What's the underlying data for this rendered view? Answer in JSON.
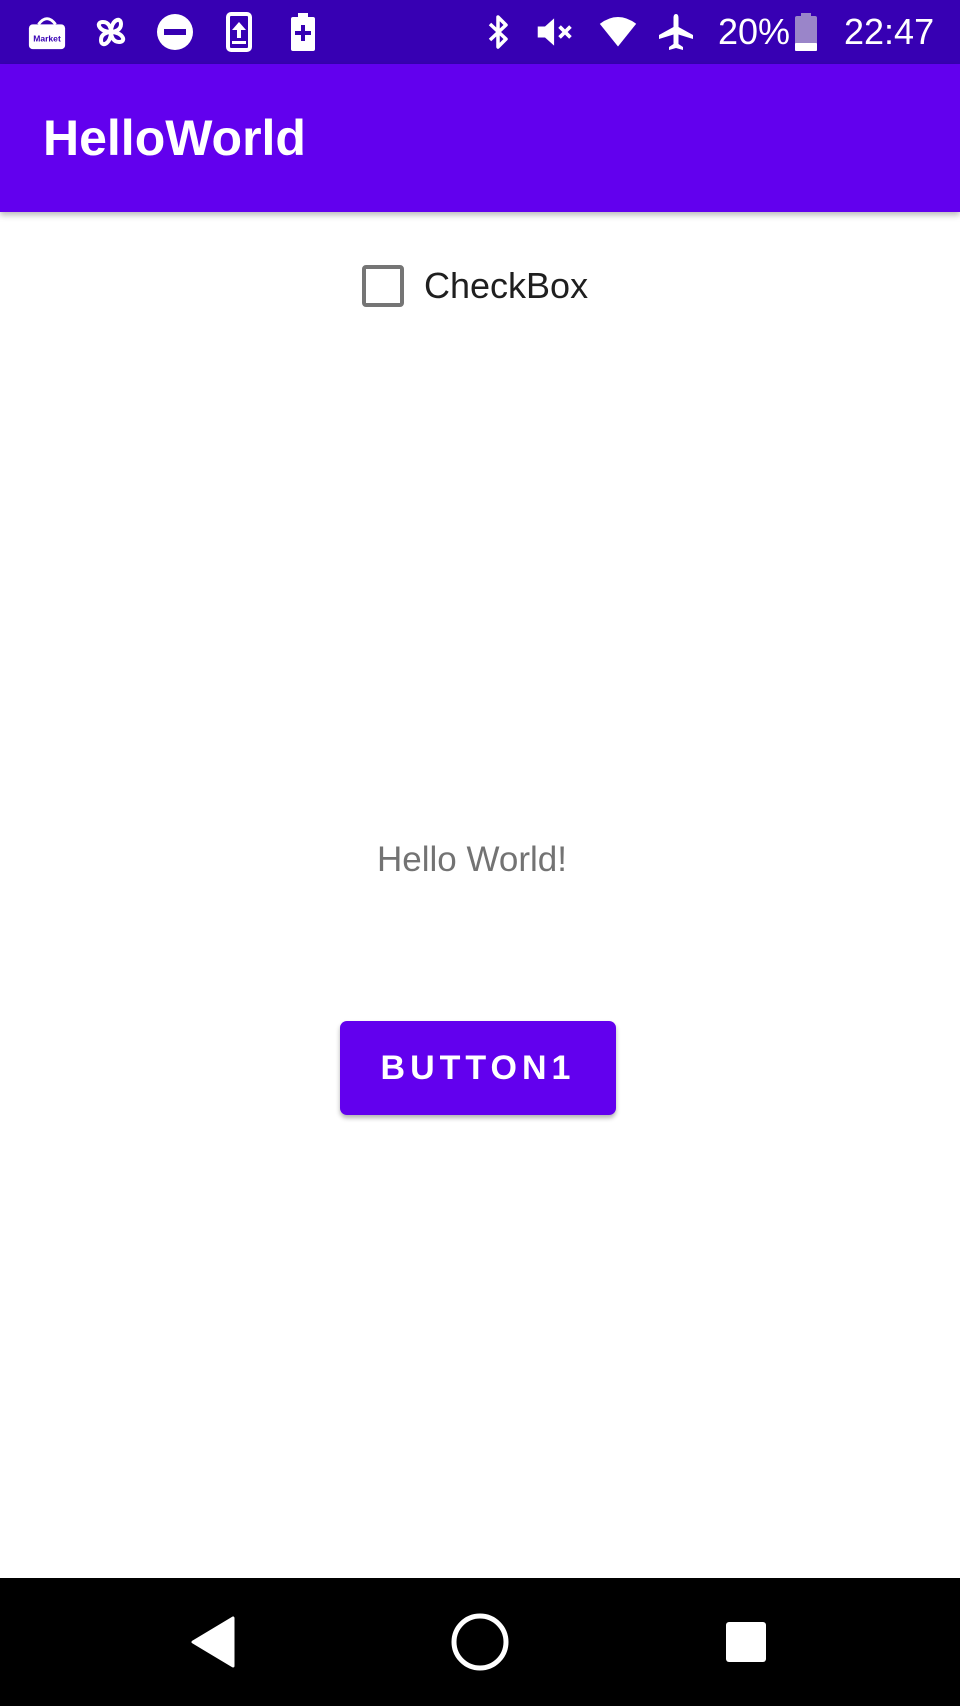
{
  "status_bar": {
    "battery_percent": "20%",
    "time": "22:47",
    "left_icons": [
      "market-icon",
      "pinwheel-icon",
      "do-not-disturb-icon",
      "phone-upload-icon",
      "battery-plus-icon"
    ],
    "right_icons": [
      "bluetooth-icon",
      "volume-muted-icon",
      "wifi-icon",
      "airplane-mode-icon",
      "battery-icon"
    ],
    "market_icon_text": "Market",
    "background_color": "#3700b3"
  },
  "app_bar": {
    "title": "HelloWorld",
    "background_color": "#6200ee"
  },
  "content": {
    "checkbox": {
      "label": "CheckBox",
      "checked": false
    },
    "hello_text": "Hello World!",
    "button": {
      "label": "BUTTON1",
      "color": "#6200ee"
    }
  },
  "nav_bar": {
    "buttons": [
      "back-icon",
      "home-icon",
      "recents-icon"
    ]
  }
}
